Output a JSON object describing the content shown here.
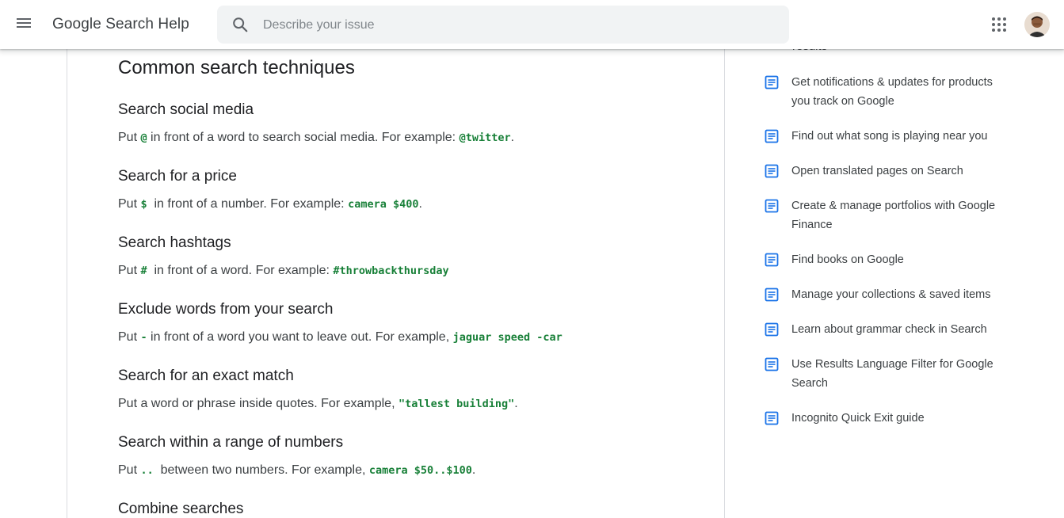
{
  "header": {
    "menu_icon": "menu-icon",
    "brand": "Google Search Help",
    "search_placeholder": "Describe your issue",
    "search_value": "",
    "apps_icon": "apps-grid-icon",
    "avatar_icon": "user-avatar"
  },
  "article": {
    "heading": "Common search techniques",
    "sections": [
      {
        "title": "Search social media",
        "pre": "Put ",
        "code": "@",
        "mid": " in front of a word to search social media. For example: ",
        "code2": "@twitter",
        "post": "."
      },
      {
        "title": "Search for a price",
        "pre": "Put ",
        "code": "$",
        "mid": "  in front of a number. For example: ",
        "code2": "camera $400",
        "post": "."
      },
      {
        "title": "Search hashtags",
        "pre": "Put ",
        "code": "#",
        "mid": "  in front of a word. For example: ",
        "code2": "#throwbackthursday",
        "post": ""
      },
      {
        "title": "Exclude words from your search",
        "pre": "Put ",
        "code": "-",
        "mid": " in front of a word you want to leave out. For example, ",
        "code2": "jaguar speed -car",
        "post": ""
      },
      {
        "title": "Search for an exact match",
        "pre": "Put a word or phrase inside quotes. For example, ",
        "code": "\"tallest building\"",
        "mid": "",
        "code2": "",
        "post": "."
      },
      {
        "title": "Search within a range of numbers",
        "pre": "Put ",
        "code": "..",
        "mid": "  between two numbers. For example, ",
        "code2": "camera $50..$100",
        "post": "."
      },
      {
        "title": "Combine searches"
      }
    ]
  },
  "sidebar": {
    "cut_text": "results",
    "items": [
      {
        "label": "Get notifications & updates for products you track on Google"
      },
      {
        "label": "Find out what song is playing near you"
      },
      {
        "label": "Open translated pages on Search"
      },
      {
        "label": "Create & manage portfolios with Google Finance"
      },
      {
        "label": "Find books on Google"
      },
      {
        "label": "Manage your collections & saved items"
      },
      {
        "label": "Learn about grammar check in Search"
      },
      {
        "label": "Use Results Language Filter for Google Search"
      },
      {
        "label": "Incognito Quick Exit guide"
      }
    ],
    "item_icon": "article-icon",
    "icon_color": "#1a73e8"
  },
  "colors": {
    "code": "#188038",
    "text": "#3c4043",
    "heading": "#202124",
    "search_bg": "#f1f3f4"
  }
}
